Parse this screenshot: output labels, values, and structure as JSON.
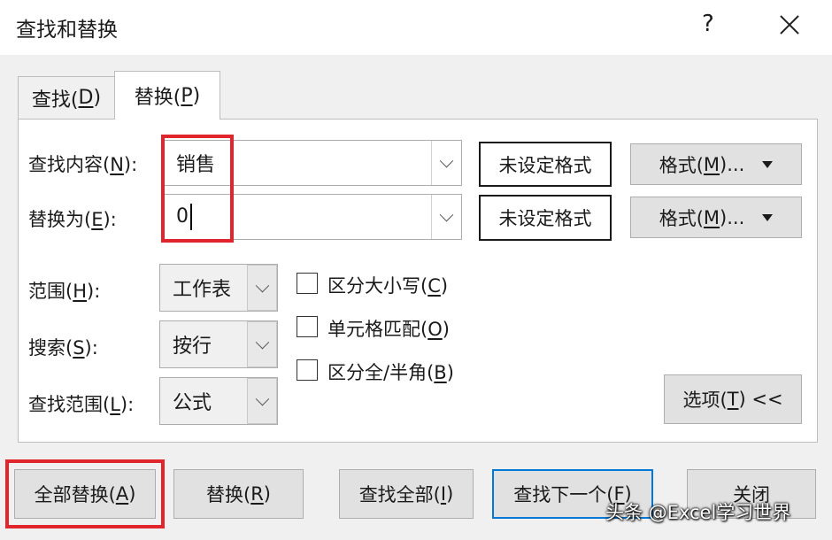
{
  "window": {
    "title": "查找和替换",
    "help_label": "?",
    "close_icon": "close-icon"
  },
  "tabs": [
    {
      "label": "查找(",
      "key": "D",
      "suffix": ")"
    },
    {
      "label": "替换(",
      "key": "P",
      "suffix": ")",
      "active": true
    }
  ],
  "find": {
    "label": "查找内容(",
    "key": "N",
    "suffix": "):",
    "value": "销售",
    "format_status": "未设定格式",
    "format_button": "格式(",
    "format_key": "M",
    "format_suffix": ")..."
  },
  "replace": {
    "label": "替换为(",
    "key": "E",
    "suffix": "):",
    "value": "0",
    "format_status": "未设定格式",
    "format_button": "格式(",
    "format_key": "M",
    "format_suffix": ")..."
  },
  "options": {
    "scope": {
      "label": "范围(",
      "key": "H",
      "suffix": "):",
      "value": "工作表"
    },
    "search": {
      "label": "搜索(",
      "key": "S",
      "suffix": "):",
      "value": "按行"
    },
    "look_in": {
      "label": "查找范围(",
      "key": "L",
      "suffix": "):",
      "value": "公式"
    },
    "checkboxes": [
      {
        "label": "区分大小写(",
        "key": "C",
        "suffix": ")",
        "checked": false
      },
      {
        "label": "单元格匹配(",
        "key": "O",
        "suffix": ")",
        "checked": false
      },
      {
        "label": "区分全/半角(",
        "key": "B",
        "suffix": ")",
        "checked": false
      }
    ],
    "options_button": "选项(",
    "options_key": "T",
    "options_suffix": ") <<"
  },
  "buttons": {
    "replace_all": {
      "label": "全部替换(",
      "key": "A",
      "suffix": ")"
    },
    "replace": {
      "label": "替换(",
      "key": "R",
      "suffix": ")"
    },
    "find_all": {
      "label": "查找全部(",
      "key": "I",
      "suffix": ")"
    },
    "find_next": {
      "label": "查找下一个(",
      "key": "F",
      "suffix": ")"
    },
    "close": {
      "label": "关闭"
    }
  },
  "watermark": "头条 @Excel学习世界",
  "colors": {
    "highlight": "#e0262c",
    "default_button_border": "#0078d7"
  }
}
